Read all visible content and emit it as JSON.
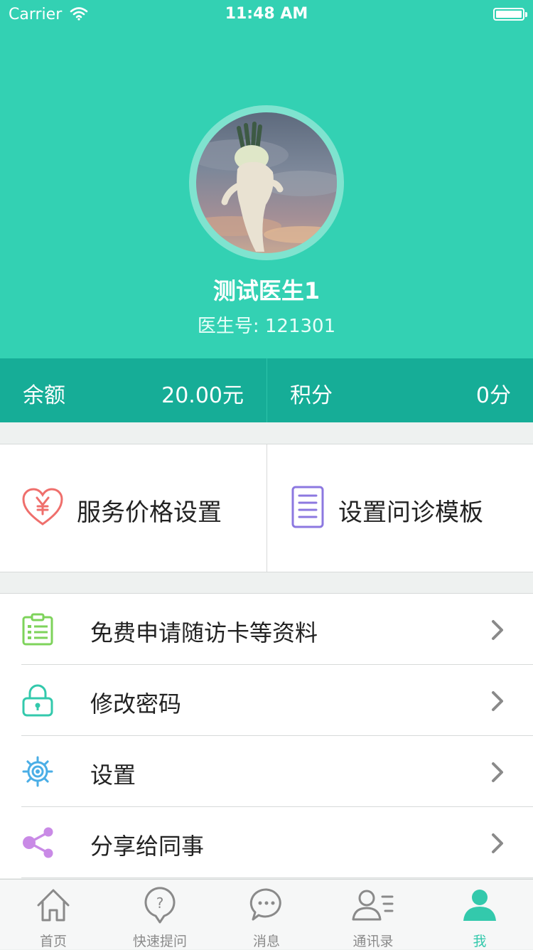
{
  "status_bar": {
    "carrier": "Carrier",
    "time": "11:48 AM"
  },
  "profile": {
    "name": "测试医生1",
    "doctor_id": "医生号: 121301"
  },
  "balance": {
    "balance_label": "余额",
    "balance_value": "20.00元",
    "points_label": "积分",
    "points_value": "0分"
  },
  "quick_actions": [
    {
      "label": "服务价格设置",
      "icon": "heart-yen-icon"
    },
    {
      "label": "设置问诊模板",
      "icon": "document-icon"
    }
  ],
  "menu": [
    {
      "label": "免费申请随访卡等资料",
      "icon": "clipboard-list-icon"
    },
    {
      "label": "修改密码",
      "icon": "lock-icon"
    },
    {
      "label": "设置",
      "icon": "gear-icon"
    },
    {
      "label": "分享给同事",
      "icon": "share-icon"
    }
  ],
  "tabs": [
    {
      "label": "首页",
      "icon": "home-icon"
    },
    {
      "label": "快速提问",
      "icon": "question-bubble-icon"
    },
    {
      "label": "消息",
      "icon": "message-bubble-icon"
    },
    {
      "label": "通讯录",
      "icon": "contacts-icon"
    },
    {
      "label": "我",
      "icon": "person-icon",
      "active": true
    }
  ],
  "colors": {
    "primary": "#33d1b3",
    "primary_dark": "#16ad97",
    "tab_active": "#33c9ac"
  }
}
